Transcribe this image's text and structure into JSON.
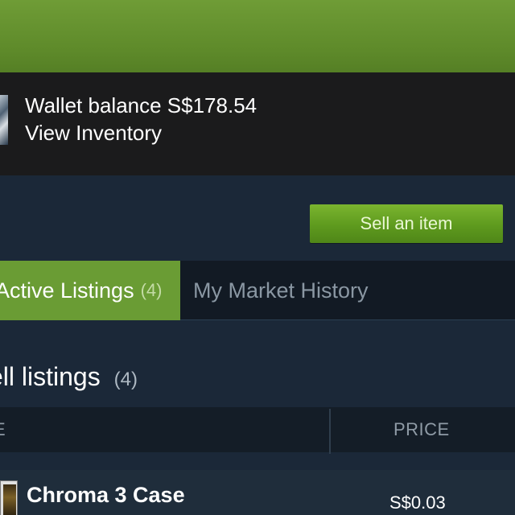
{
  "colors": {
    "background": "#1b2838",
    "banner_green": "#6f9c36",
    "wallet_bar": "#1b1b1c",
    "accent_green": "#6a9c34",
    "button_green": "#6aa42a",
    "tab_bar": "#121a24",
    "muted_text": "#8a97a3"
  },
  "wallet": {
    "balance_text": "Wallet balance S$178.54",
    "inventory_link": "View Inventory",
    "thumbnail_icon": "inventory-item-thumbnail"
  },
  "actions": {
    "sell_label": "Sell an item"
  },
  "tabs": [
    {
      "label": "Active Listings",
      "count": "(4)",
      "active": true
    },
    {
      "label": "My Market History",
      "active": false
    }
  ],
  "sell_listings": {
    "title": "ell listings",
    "count": "(4)",
    "columns": {
      "name": "E",
      "price": "PRICE"
    },
    "rows": [
      {
        "name": "Chroma 3 Case",
        "price": "S$0.03",
        "icon": "weapon-case-icon"
      }
    ]
  }
}
